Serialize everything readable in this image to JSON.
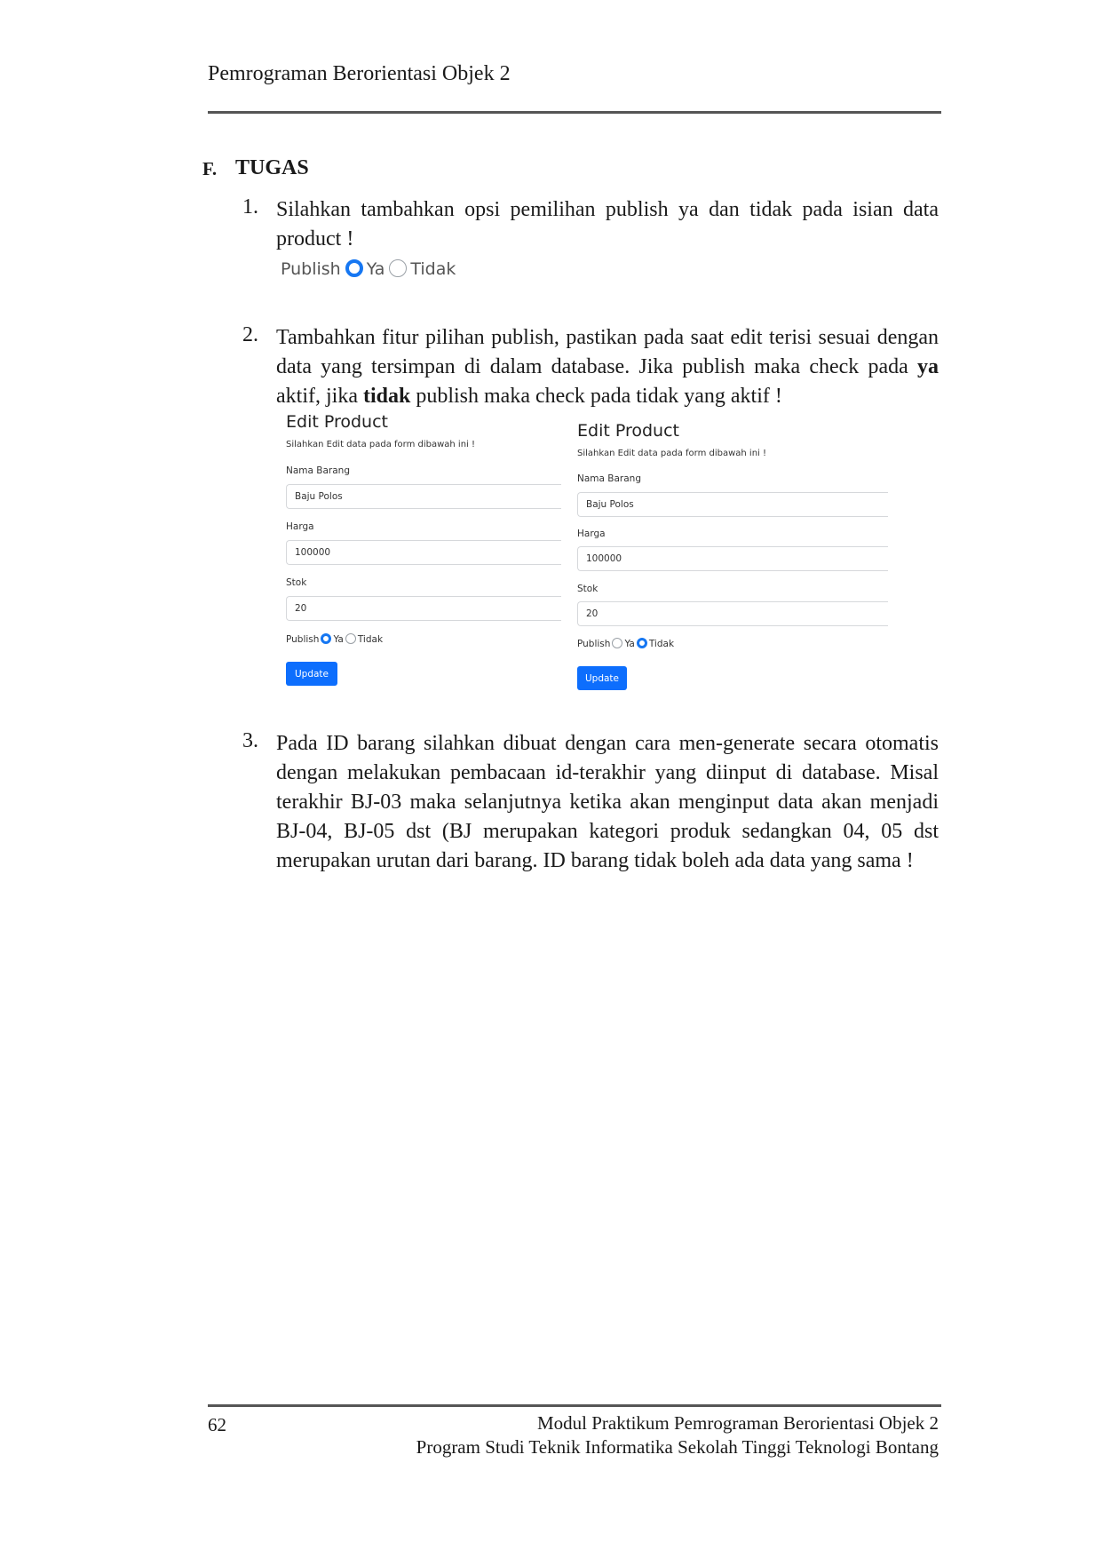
{
  "header": {
    "title": "Pemrograman Berorientasi Objek 2"
  },
  "section": {
    "letter": "F.",
    "title": "TUGAS"
  },
  "items": [
    {
      "number": "1.",
      "text": "Silahkan tambahkan opsi pemilihan publish ya dan tidak pada isian data product !"
    },
    {
      "number": "2.",
      "text_a": "Tambahkan fitur pilihan publish, pastikan pada saat edit terisi sesuai dengan data yang tersimpan di dalam database. Jika publish maka check pada ",
      "bold_a": "ya",
      "text_b": " aktif, jika ",
      "bold_b": "tidak",
      "text_c": " publish maka check pada tidak yang aktif !"
    },
    {
      "number": "3.",
      "text": "Pada ID barang silahkan dibuat dengan cara men-generate secara otomatis dengan melakukan pembacaan id-terakhir yang diinput di database. Misal terakhir BJ-03 maka selanjutnya ketika akan menginput data akan menjadi BJ-04, BJ-05 dst (BJ merupakan kategori produk sedangkan 04, 05 dst merupakan urutan dari barang. ID barang tidak boleh ada data yang sama !"
    }
  ],
  "publish_demo": {
    "label": "Publish",
    "option_yes": "Ya",
    "option_no": "Tidak",
    "selected": "Ya"
  },
  "edit_forms": [
    {
      "title": "Edit Product",
      "subtitle": "Silahkan Edit data pada form dibawah ini !",
      "nama_label": "Nama Barang",
      "nama_value": "Baju Polos",
      "harga_label": "Harga",
      "harga_value": "100000",
      "stok_label": "Stok",
      "stok_value": "20",
      "publish_label": "Publish",
      "option_yes": "Ya",
      "option_no": "Tidak",
      "selected": "Ya",
      "button": "Update"
    },
    {
      "title": "Edit Product",
      "subtitle": "Silahkan Edit data pada form dibawah ini !",
      "nama_label": "Nama Barang",
      "nama_value": "Baju Polos",
      "harga_label": "Harga",
      "harga_value": "100000",
      "stok_label": "Stok",
      "stok_value": "20",
      "publish_label": "Publish",
      "option_yes": "Ya",
      "option_no": "Tidak",
      "selected": "Tidak",
      "button": "Update"
    }
  ],
  "footer": {
    "page_number": "62",
    "line1": "Modul Praktikum Pemrograman Berorientasi Objek 2",
    "line2": "Program Studi Teknik Informatika Sekolah Tinggi Teknologi Bontang"
  },
  "colors": {
    "accent": "#0d6efd",
    "rule": "#555555"
  }
}
